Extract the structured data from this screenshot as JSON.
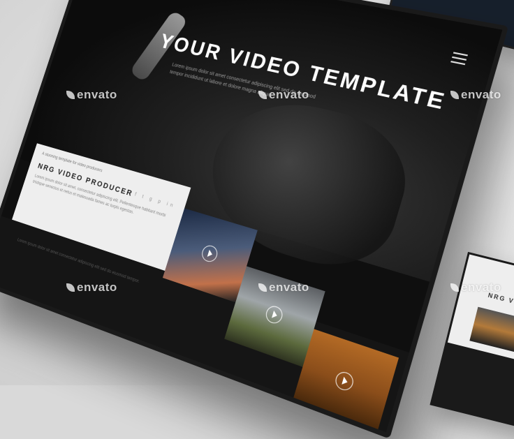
{
  "hero": {
    "title": "YOUR VIDEO TEMPLATE",
    "subtitle": "Lorem ipsum dolor sit amet consectetur adipiscing elit sed do eiusmod tempor incididunt ut labore et dolore magna aliqua."
  },
  "card": {
    "kicker": "A stunning template for video producers",
    "title": "NRG VIDEO PRODUCER",
    "text": "Lorem ipsum dolor sit amet, consectetur adipiscing elit. Pellentesque habitant morbi tristique senectus et netus et malesuada fames ac turpis egestas.",
    "social": "f t g p in"
  },
  "footer": {
    "text": "Lorem ipsum dolor sit amet consectetur adipiscing elit sed do eiusmod tempor."
  },
  "side_device": {
    "title": "NRG VIDEO P"
  },
  "watermarks": [
    "envato",
    "envato",
    "envato",
    "envato",
    "envato",
    "envato"
  ],
  "colors": {
    "accent": "#ffffff",
    "background": "#0f0f0f"
  }
}
